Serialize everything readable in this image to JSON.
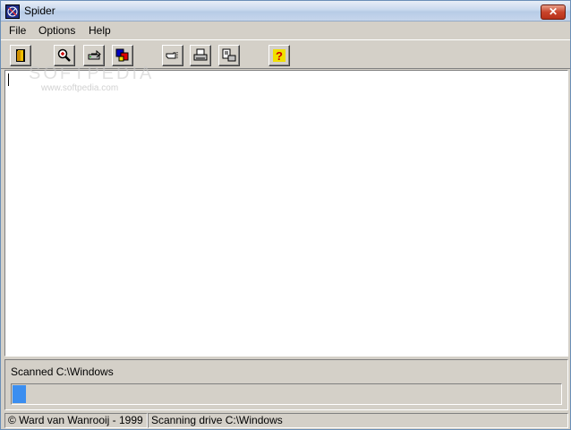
{
  "window": {
    "title": "Spider"
  },
  "menu": {
    "items": [
      "File",
      "Options",
      "Help"
    ]
  },
  "toolbar": {
    "buttons": [
      {
        "icon": "exit-door-icon"
      },
      {
        "icon": "magnifier-icon"
      },
      {
        "icon": "drive-arrow-icon"
      },
      {
        "icon": "color-palette-icon"
      },
      {
        "icon": "pointing-hand-icon"
      },
      {
        "icon": "printer-icon"
      },
      {
        "icon": "print-preview-icon"
      },
      {
        "icon": "help-question-icon"
      }
    ]
  },
  "watermark": {
    "brand": "SOFTPEDIA",
    "url": "www.softpedia.com"
  },
  "status": {
    "scanned_label": "Scanned C:\\Windows",
    "progress": 0.025,
    "progress_color": "#3b8ef0",
    "copyright": "© Ward van Wanrooij - 1999",
    "message": "Scanning drive C:\\Windows"
  }
}
